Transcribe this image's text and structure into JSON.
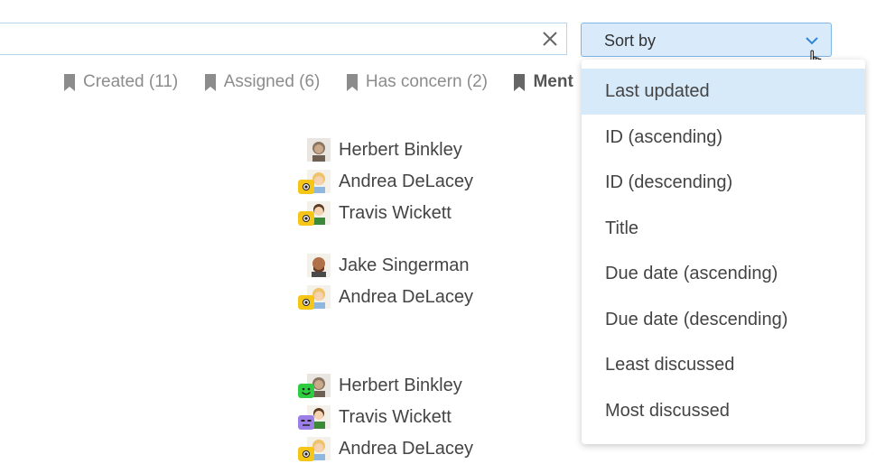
{
  "search": {
    "value": "",
    "placeholder": ""
  },
  "sort": {
    "label": "Sort by"
  },
  "filters": [
    {
      "label": "Created (11)"
    },
    {
      "label": "Assigned (6)"
    },
    {
      "label": "Has concern (2)"
    },
    {
      "label": "Ment"
    }
  ],
  "people": [
    {
      "name": "Herbert Binkley",
      "badge": "",
      "avatar_color": "#6b5a4a"
    },
    {
      "name": "Andrea DeLacey",
      "badge": "eye",
      "avatar_color": "#e8b46a"
    },
    {
      "name": "Travis Wickett",
      "badge": "eye",
      "avatar_color": "#3a7d3a"
    },
    {
      "name": "Jake Singerman",
      "badge": "",
      "avatar_color": "#a0522d"
    },
    {
      "name": "Andrea DeLacey",
      "badge": "eye",
      "avatar_color": "#e8b46a"
    },
    {
      "name": "Herbert Binkley",
      "badge": "smile",
      "avatar_color": "#6b5a4a"
    },
    {
      "name": "Travis Wickett",
      "badge": "flat",
      "avatar_color": "#3a7d3a"
    },
    {
      "name": "Andrea DeLacey",
      "badge": "eye",
      "avatar_color": "#e8b46a"
    }
  ],
  "dropdown": {
    "items": [
      {
        "label": "Last updated",
        "selected": true
      },
      {
        "label": "ID (ascending)"
      },
      {
        "label": "ID (descending)"
      },
      {
        "label": "Title"
      },
      {
        "label": "Due date (ascending)"
      },
      {
        "label": "Due date (descending)"
      },
      {
        "label": "Least discussed"
      },
      {
        "label": "Most discussed"
      }
    ]
  },
  "colors": {
    "accent": "#2f86d6",
    "sort_bg": "#d9ebfb",
    "selected_bg": "#d6eafa",
    "badge_yellow": "#f5c518",
    "badge_green": "#2ecc40",
    "badge_purple": "#9b7fe6"
  }
}
